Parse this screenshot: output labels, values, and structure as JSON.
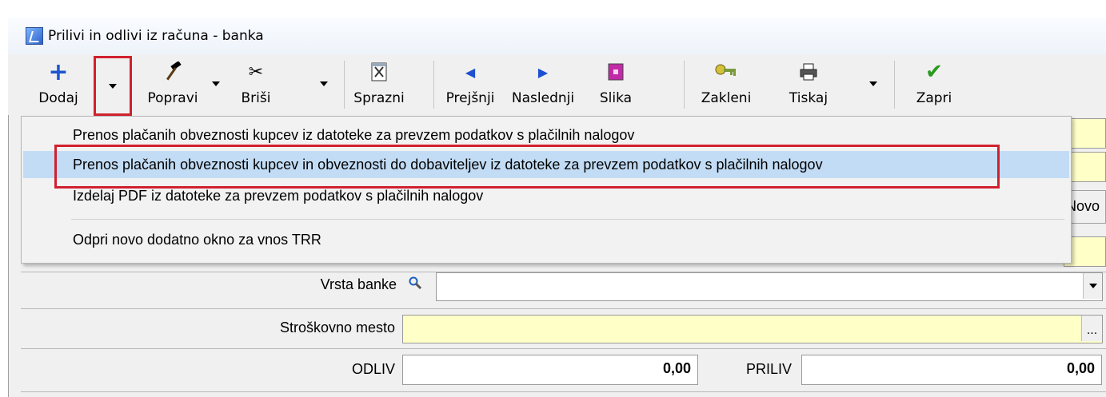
{
  "window": {
    "title": "Prilivi in odlivi iz računa - banka"
  },
  "toolbar": {
    "dodaj": "Dodaj",
    "popravi": "Popravi",
    "brisi": "Briši",
    "sprazni": "Sprazni",
    "prejsnji": "Prejšnji",
    "naslednji": "Naslednji",
    "slika": "Slika",
    "zakleni": "Zakleni",
    "tiskaj": "Tiskaj",
    "zapri": "Zapri"
  },
  "menu": {
    "items": [
      "Prenos plačanih obveznosti kupcev iz datoteke za prevzem podatkov s plačilnih nalogov",
      "Prenos plačanih obveznosti kupcev in obveznosti do dobaviteljev iz datoteke za prevzem podatkov s plačilnih nalogov",
      "Izdelaj PDF iz datoteke za prevzem podatkov s plačilnih nalogov",
      "Odpri novo dodatno okno za vnos TRR"
    ]
  },
  "form": {
    "novo_label": "Novo",
    "vrsta_banke_label": "Vrsta banke",
    "vrsta_banke_value": "",
    "stroskovno_mesto_label": "Stroškovno mesto",
    "stroskovno_mesto_value": "",
    "odliv_label": "ODLIV",
    "odliv_value": "0,00",
    "priliv_label": "PRILIV",
    "priliv_value": "0,00",
    "ellipsis": "..."
  },
  "colors": {
    "highlight_box": "#d1202e",
    "menu_highlight": "#c2dcf5",
    "yellow_field": "#ffffc8"
  }
}
